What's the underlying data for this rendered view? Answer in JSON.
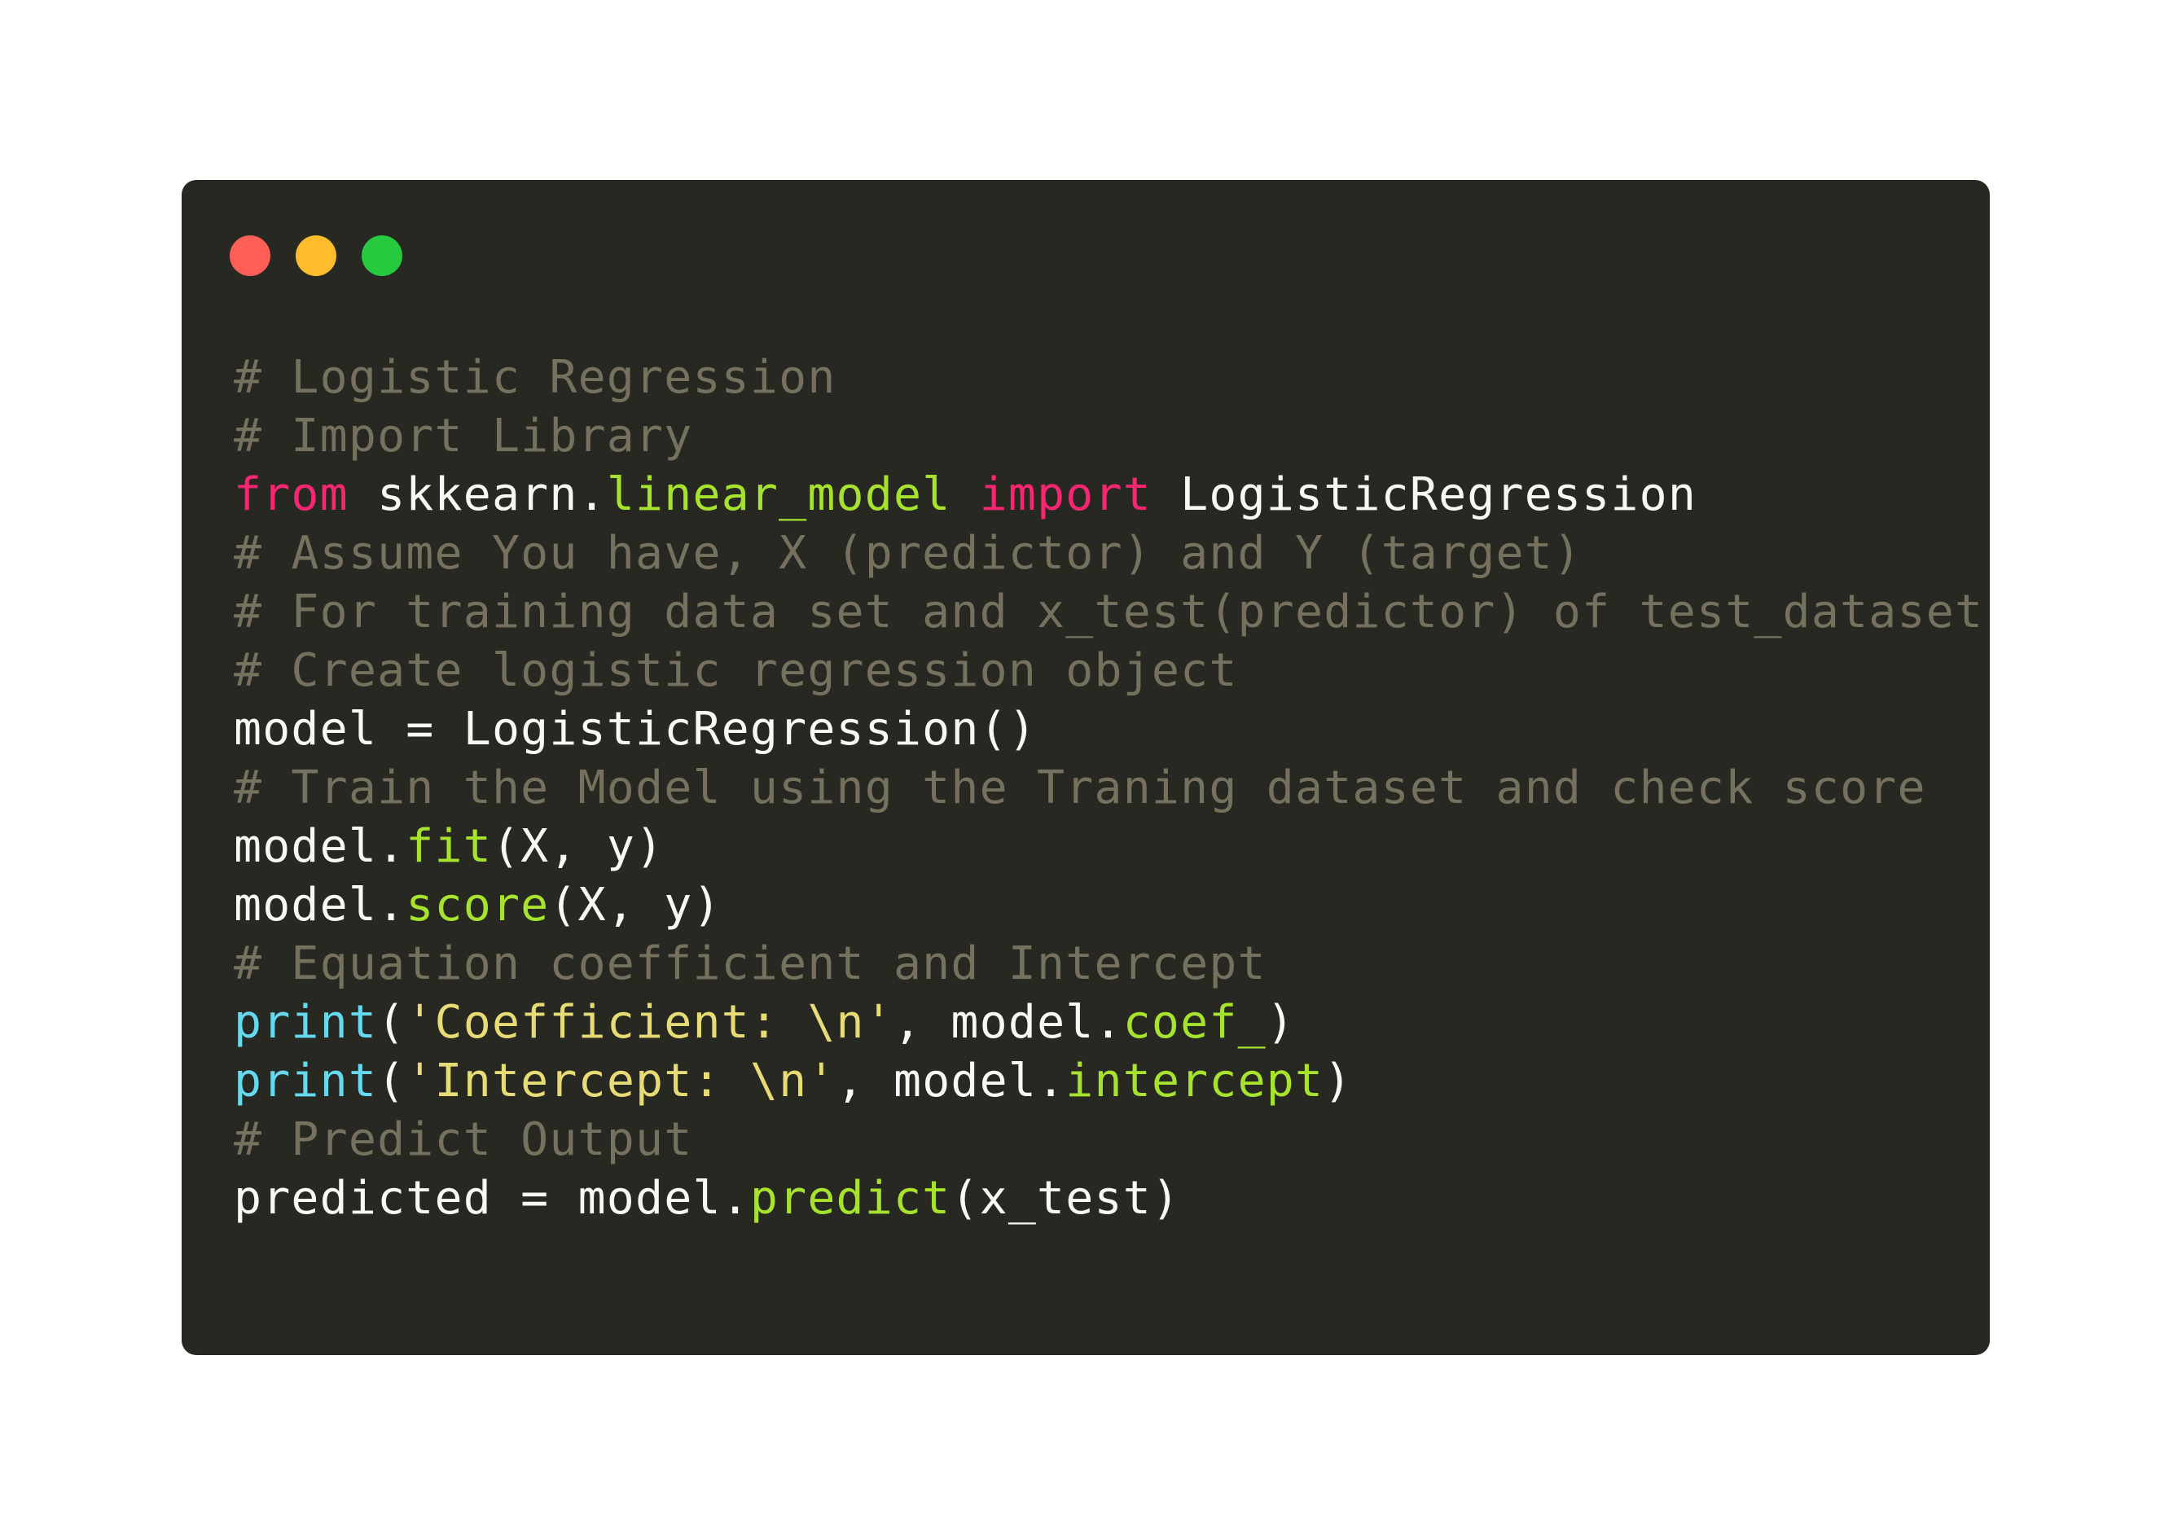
{
  "window": {
    "controls": [
      {
        "name": "close",
        "color": "#ff5f56"
      },
      {
        "name": "minimize",
        "color": "#ffbd2e"
      },
      {
        "name": "maximize",
        "color": "#27c93f"
      }
    ]
  },
  "theme": {
    "background": "#272822",
    "comment": "#75715e",
    "keyword": "#f92672",
    "function": "#a6e22e",
    "builtin": "#66d9ef",
    "string": "#e6db74",
    "plain": "#f8f8f2"
  },
  "code": {
    "lines": [
      [
        {
          "t": "comment",
          "v": "# Logistic Regression"
        }
      ],
      [
        {
          "t": "comment",
          "v": "# Import Library"
        }
      ],
      [
        {
          "t": "keyword",
          "v": "from"
        },
        {
          "t": "plain",
          "v": " skkearn."
        },
        {
          "t": "func",
          "v": "linear_model"
        },
        {
          "t": "plain",
          "v": " "
        },
        {
          "t": "keyword",
          "v": "import"
        },
        {
          "t": "plain",
          "v": " LogisticRegression"
        }
      ],
      [
        {
          "t": "comment",
          "v": "# Assume You have, X (predictor) and Y (target)"
        }
      ],
      [
        {
          "t": "comment",
          "v": "# For training data set and x_test(predictor) of test_dataset"
        }
      ],
      [
        {
          "t": "comment",
          "v": "# Create logistic regression object"
        }
      ],
      [
        {
          "t": "plain",
          "v": "model = LogisticRegression()"
        }
      ],
      [
        {
          "t": "comment",
          "v": "# Train the Model using the Traning dataset and check score"
        }
      ],
      [
        {
          "t": "plain",
          "v": "model."
        },
        {
          "t": "func",
          "v": "fit"
        },
        {
          "t": "plain",
          "v": "(X, y)"
        }
      ],
      [
        {
          "t": "plain",
          "v": "model."
        },
        {
          "t": "func",
          "v": "score"
        },
        {
          "t": "plain",
          "v": "(X, y)"
        }
      ],
      [
        {
          "t": "comment",
          "v": "# Equation coefficient and Intercept"
        }
      ],
      [
        {
          "t": "builtin",
          "v": "print"
        },
        {
          "t": "plain",
          "v": "("
        },
        {
          "t": "string",
          "v": "'Coefficient: \\n'"
        },
        {
          "t": "plain",
          "v": ", model."
        },
        {
          "t": "func",
          "v": "coef_"
        },
        {
          "t": "plain",
          "v": ")"
        }
      ],
      [
        {
          "t": "builtin",
          "v": "print"
        },
        {
          "t": "plain",
          "v": "("
        },
        {
          "t": "string",
          "v": "'Intercept: \\n'"
        },
        {
          "t": "plain",
          "v": ", model."
        },
        {
          "t": "func",
          "v": "intercept"
        },
        {
          "t": "plain",
          "v": ")"
        }
      ],
      [
        {
          "t": "comment",
          "v": "# Predict Output"
        }
      ],
      [
        {
          "t": "plain",
          "v": "predicted = model."
        },
        {
          "t": "func",
          "v": "predict"
        },
        {
          "t": "plain",
          "v": "(x_test)"
        }
      ]
    ]
  }
}
